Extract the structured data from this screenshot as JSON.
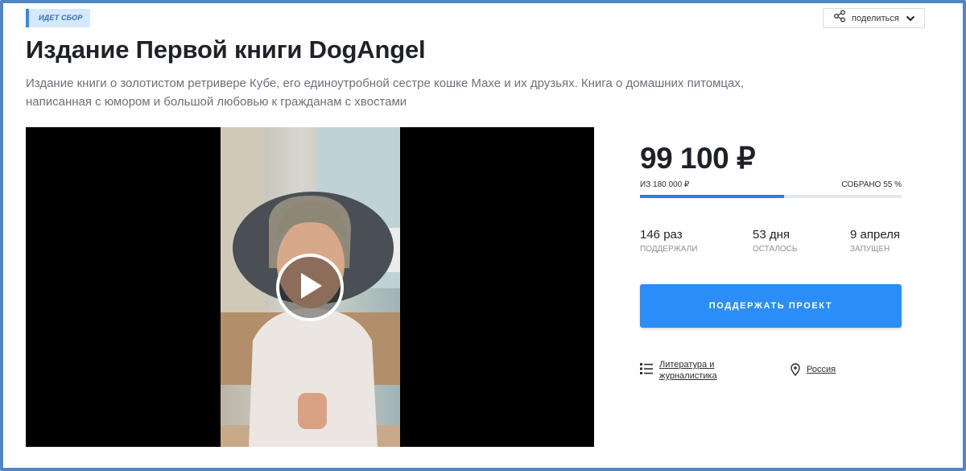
{
  "status_badge": "ИДЕТ СБОР",
  "share": {
    "label": "поделиться"
  },
  "project": {
    "title": "Издание Первой книги DogAngel",
    "description": "Издание книги о золотистом ретривере Кубе, его единоутробной сестре кошке Махе и их друзьях. Книга о домашних питомцах, написанная с юмором и большой любовью к гражданам с хвостами"
  },
  "funding": {
    "raised": "99 100 ₽",
    "goal": "из 180 000 ₽",
    "collected": "собрано 55 %",
    "progress": 0.55
  },
  "stats": [
    {
      "value": "146 раз",
      "label": "поддержали"
    },
    {
      "value": "53 дня",
      "label": "осталось"
    },
    {
      "value": "9 апреля",
      "label": "запущен"
    }
  ],
  "cta": {
    "label": "Поддержать проект"
  },
  "meta": {
    "category": "Литература и журналистика",
    "location": "Россия"
  },
  "colors": {
    "accent": "#2b8df8",
    "progress": "#2e7fe0",
    "frame": "#4f86c6"
  }
}
